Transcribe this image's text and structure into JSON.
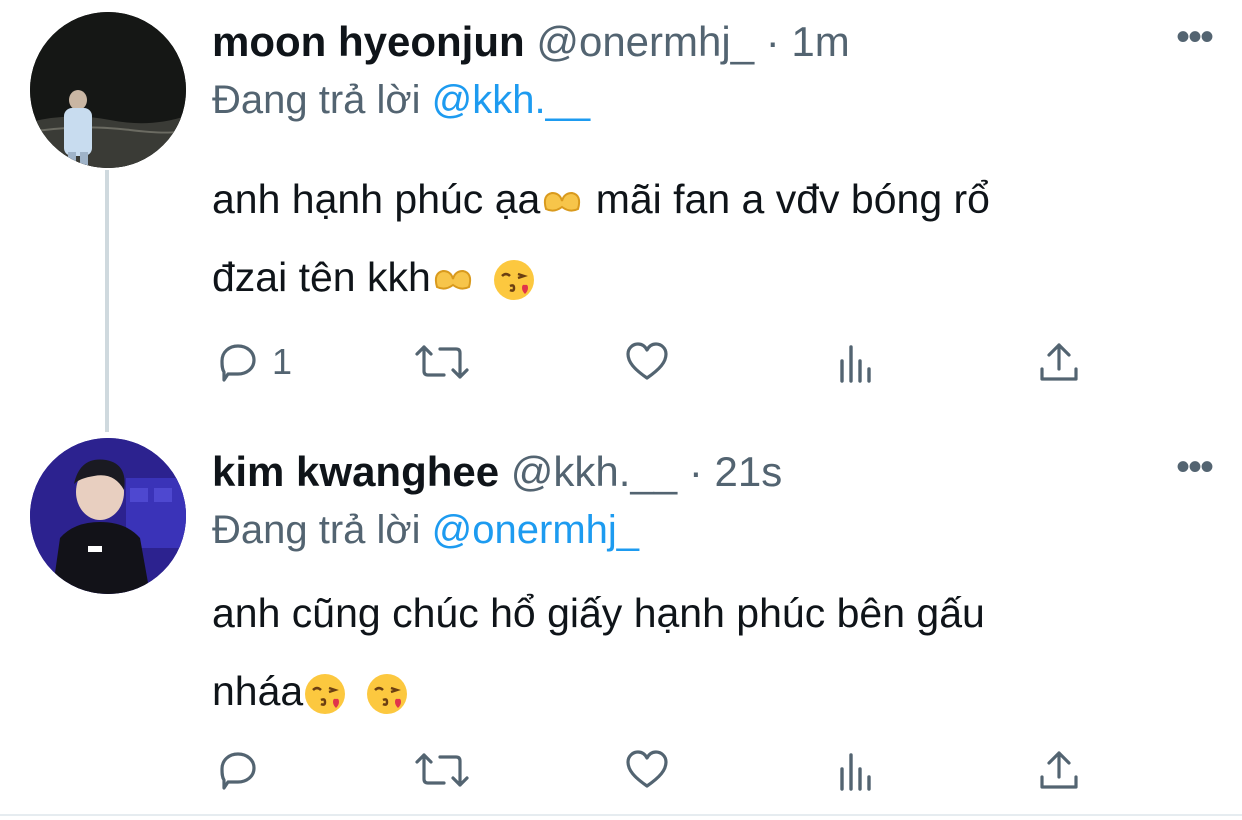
{
  "tweets": [
    {
      "name": "moon hyeonjun",
      "handle": "@onermhj_",
      "dot": "·",
      "time": "1m",
      "reply_prefix": "Đang trả lời ",
      "reply_mention": "@kkh.__",
      "text_line1": "anh hạnh phúc ạa",
      "text_line1b": " mãi fan a vđv bóng rổ",
      "text_line2": "đzai tên kkh",
      "reply_count": "1",
      "icons": [
        "reply-icon",
        "retweet-icon",
        "like-icon",
        "views-icon",
        "share-icon"
      ]
    },
    {
      "name": "kim kwanghee",
      "handle": "@kkh.__",
      "dot": "·",
      "time": "21s",
      "reply_prefix": "Đang trả lời ",
      "reply_mention": "@onermhj_",
      "text_line1": "anh cũng chúc hổ giấy hạnh phúc bên gấu",
      "text_line2": "nháa",
      "reply_count": "",
      "icons": [
        "reply-icon",
        "retweet-icon",
        "like-icon",
        "views-icon",
        "share-icon"
      ]
    }
  ],
  "more_label": "•••",
  "colors": {
    "secondary": "#536471",
    "link": "#1d9bf0",
    "text": "#0f1419"
  }
}
